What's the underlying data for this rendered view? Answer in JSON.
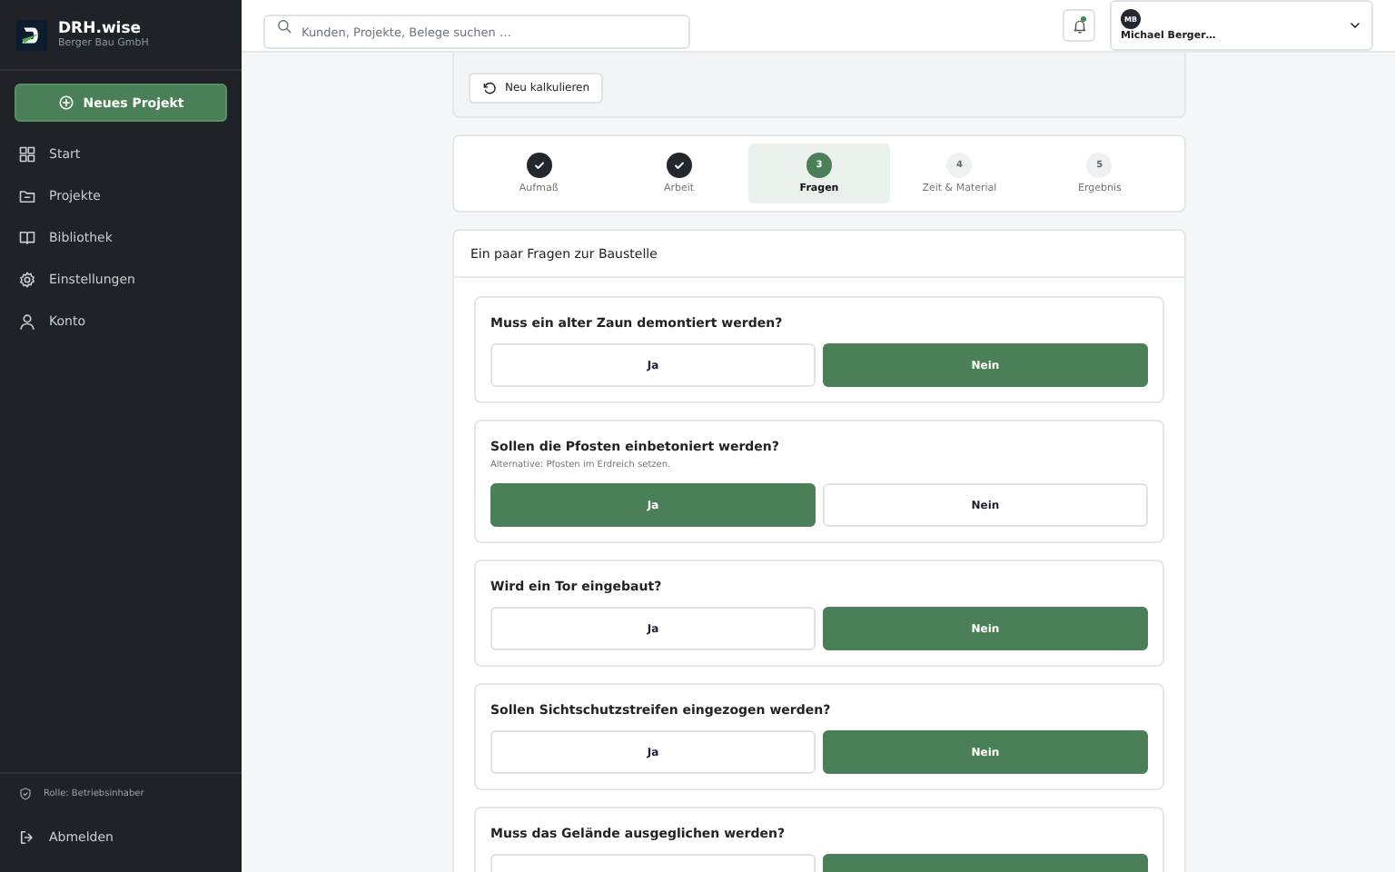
{
  "sidebar": {
    "app_name": "DRH.wise",
    "company": "Berger Bau GmbH",
    "new_button": "Neues Projekt",
    "items": [
      {
        "label": "Start"
      },
      {
        "label": "Projekte"
      },
      {
        "label": "Bibliothek"
      },
      {
        "label": "Einstellungen"
      },
      {
        "label": "Konto"
      }
    ],
    "role": "Rolle: Betriebsinhaber",
    "logout": "Abmelden"
  },
  "header": {
    "search": {
      "placeholder": "Kunden, Projekte, Belege suchen …"
    },
    "notification_dot": true,
    "user": {
      "initials": "MB",
      "name": "Michael Berger…"
    }
  },
  "recalc_button": "Neu kalkulieren",
  "steps": [
    {
      "label": "Aufmaß",
      "done": true,
      "selected": false
    },
    {
      "label": "Arbeit",
      "done": true,
      "selected": false
    },
    {
      "label": "Fragen",
      "number": "3",
      "done": false,
      "selected": true
    },
    {
      "label": "Zeit & Material",
      "number": "4",
      "done": false,
      "selected": false
    },
    {
      "label": "Ergebnis",
      "number": "5",
      "done": false,
      "selected": false
    }
  ],
  "questions_title": "Ein paar Fragen zur Baustelle",
  "questions": [
    {
      "text": "Muss ein alter Zaun demontiert werden?",
      "options": [
        {
          "label": "Ja",
          "selected": false
        },
        {
          "label": "Nein",
          "selected": true
        }
      ]
    },
    {
      "text": "Sollen die Pfosten einbetoniert werden?",
      "hint": "Alternative: Pfosten im Erdreich setzen.",
      "options": [
        {
          "label": "Ja",
          "selected": true
        },
        {
          "label": "Nein",
          "selected": false
        }
      ]
    },
    {
      "text": "Wird ein Tor eingebaut?",
      "options": [
        {
          "label": "Ja",
          "selected": false
        },
        {
          "label": "Nein",
          "selected": true
        }
      ]
    },
    {
      "text": "Sollen Sichtschutzstreifen eingezogen werden?",
      "options": [
        {
          "label": "Ja",
          "selected": false
        },
        {
          "label": "Nein",
          "selected": true
        }
      ]
    },
    {
      "text": "Muss das Gelände ausgeglichen werden?",
      "options": [
        {
          "selected": false
        },
        {
          "selected": true
        }
      ]
    }
  ]
}
